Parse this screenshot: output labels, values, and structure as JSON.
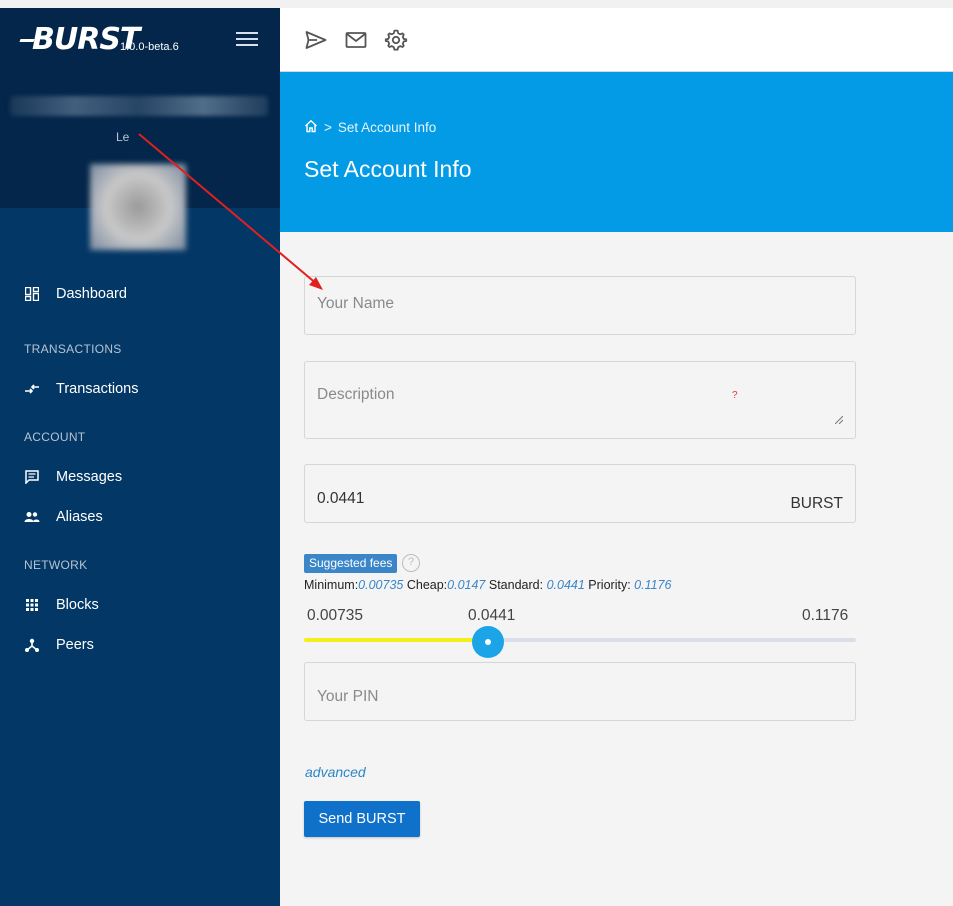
{
  "app": {
    "logo": "BURST",
    "version": "1.0.0-beta.6",
    "account_name": "Le"
  },
  "sidebar": {
    "items": [
      {
        "label": "Dashboard",
        "icon": "dashboard-icon"
      },
      {
        "section": "TRANSACTIONS"
      },
      {
        "label": "Transactions",
        "icon": "transactions-icon"
      },
      {
        "section": "ACCOUNT"
      },
      {
        "label": "Messages",
        "icon": "messages-icon"
      },
      {
        "label": "Aliases",
        "icon": "aliases-icon"
      },
      {
        "section": "NETWORK"
      },
      {
        "label": "Blocks",
        "icon": "blocks-icon"
      },
      {
        "label": "Peers",
        "icon": "peers-icon"
      }
    ]
  },
  "toolbar": {
    "icons": [
      "send-icon",
      "mail-icon",
      "settings-icon"
    ]
  },
  "header": {
    "breadcrumb_home_icon": "home-icon",
    "breadcrumb_sep": ">",
    "breadcrumb_current": "Set Account Info",
    "title": "Set Account Info"
  },
  "form": {
    "name_placeholder": "Your Name",
    "description_placeholder": "Description",
    "description_marker": "?",
    "fee_value": "0.0441",
    "fee_unit": "BURST",
    "suggested_fees_label": "Suggested fees",
    "help_symbol": "?",
    "fees": {
      "minimum_label": "Minimum:",
      "minimum": "0.00735",
      "cheap_label": "Cheap:",
      "cheap": "0.0147",
      "standard_label": "Standard:",
      "standard": "0.0441",
      "priority_label": "Priority:",
      "priority": "0.1176"
    },
    "slider": {
      "min_label": "0.00735",
      "current_label": "0.0441",
      "max_label": "0.1176",
      "min": 0.00735,
      "max": 0.1176,
      "value": 0.0441
    },
    "pin_placeholder": "Your PIN",
    "advanced_label": "advanced",
    "submit_label": "Send BURST"
  },
  "colors": {
    "sidebar": "#033766",
    "sidebar_header": "#03264a",
    "header": "#039be5",
    "button": "#0f71c9",
    "slider_fill": "#f4ef1a",
    "slider_thumb": "#1ba4e8",
    "annotation_arrow": "#e02020"
  }
}
